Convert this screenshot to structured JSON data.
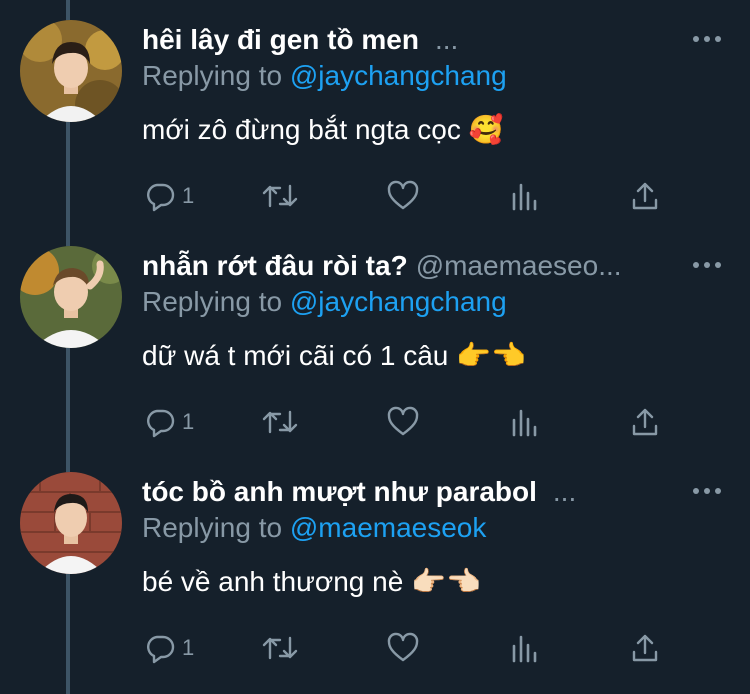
{
  "colors": {
    "background": "#15202b",
    "muted": "#8899a6",
    "link": "#1da1f2",
    "thread_line": "#3d5466"
  },
  "replies": [
    {
      "display_name": "hêi lây đi gen tồ men",
      "handle": "",
      "ellipsis": "...",
      "reply_prefix": "Replying to",
      "reply_to": "@jaychangchang",
      "text": "mới zô đừng bắt ngta cọc 🥰",
      "reply_count": "1"
    },
    {
      "display_name": "nhẫn rớt đâu ròi ta?",
      "handle": "@maemaeseo...",
      "ellipsis": "",
      "reply_prefix": "Replying to",
      "reply_to": "@jaychangchang",
      "text": "dữ wá t mới cãi có 1 câu 👉👈",
      "reply_count": "1"
    },
    {
      "display_name": "tóc bồ anh mượt như parabol",
      "handle": "",
      "ellipsis": "...",
      "reply_prefix": "Replying to",
      "reply_to": "@maemaeseok",
      "text": "bé về anh thương nè 👉🏻👈🏻",
      "reply_count": "1"
    }
  ],
  "icons": {
    "more": "more-horizontal-icon",
    "reply": "speech-bubble-icon",
    "retweet": "retweet-icon",
    "like": "heart-icon",
    "analytics": "bar-chart-icon",
    "share": "share-upload-icon"
  }
}
